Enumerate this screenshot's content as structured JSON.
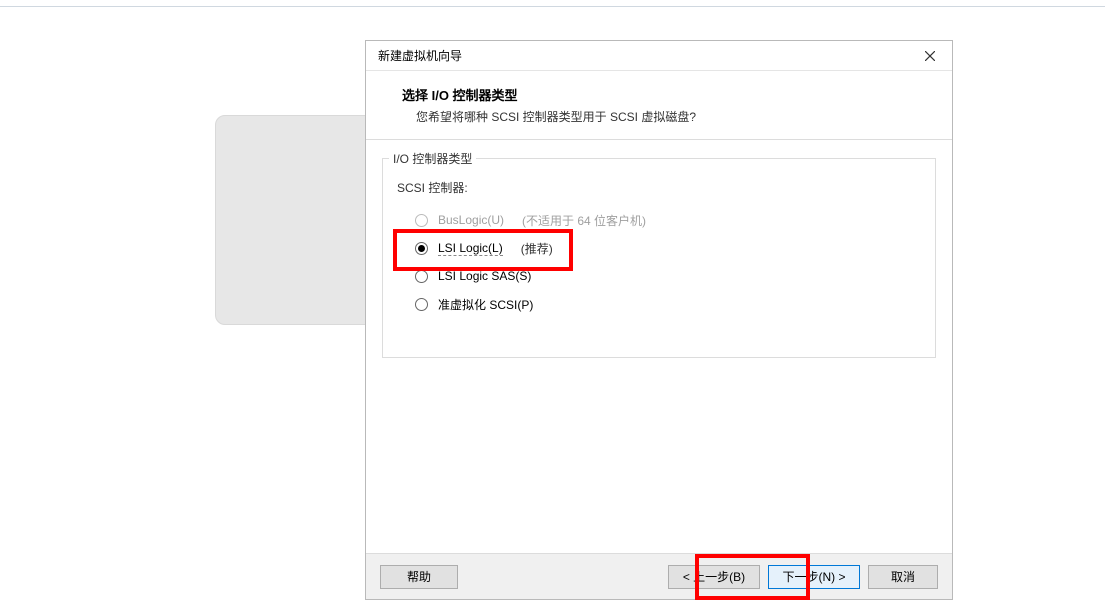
{
  "dialog": {
    "title": "新建虚拟机向导",
    "heading": "选择 I/O 控制器类型",
    "subheading": "您希望将哪种 SCSI 控制器类型用于 SCSI 虚拟磁盘?"
  },
  "group": {
    "legend": "I/O 控制器类型",
    "scsi_label": "SCSI 控制器:",
    "options": [
      {
        "label": "BusLogic(U)",
        "note": "(不适用于 64 位客户机)",
        "enabled": false,
        "selected": false
      },
      {
        "label": "LSI Logic(L)",
        "note": "(推荐)",
        "enabled": true,
        "selected": true
      },
      {
        "label": "LSI Logic SAS(S)",
        "note": "",
        "enabled": true,
        "selected": false
      },
      {
        "label": "准虚拟化 SCSI(P)",
        "note": "",
        "enabled": true,
        "selected": false
      }
    ]
  },
  "buttons": {
    "help": "帮助",
    "back": "< 上一步(B)",
    "next": "下一步(N) >",
    "cancel": "取消"
  }
}
